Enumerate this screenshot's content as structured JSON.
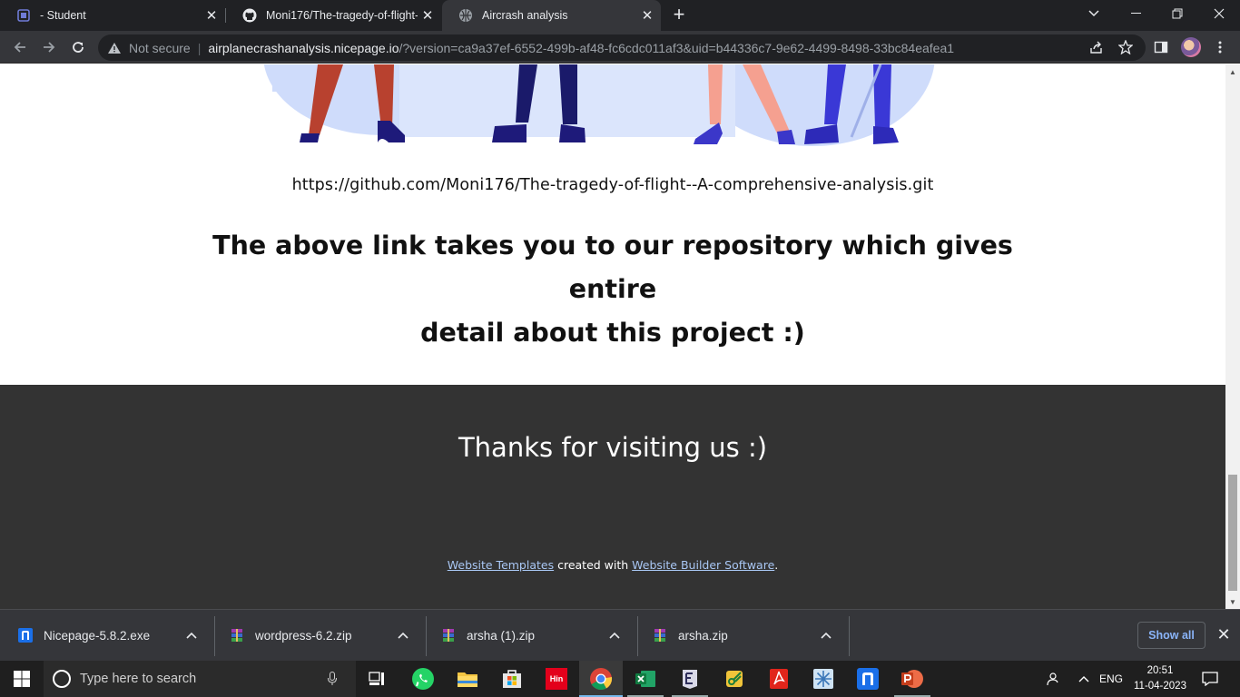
{
  "tabs": [
    {
      "title": "- Student",
      "icon": "teams-icon"
    },
    {
      "title": "Moni176/The-tragedy-of-flight--",
      "icon": "github-icon"
    },
    {
      "title": "Aircrash analysis",
      "icon": "globe-icon",
      "active": true
    }
  ],
  "address": {
    "security": "Not secure",
    "host": "airplanecrashanalysis.nicepage.io",
    "path": "/?version=ca9a37ef-6552-499b-af48-fc6cdc011af3&uid=b44336c7-9e62-4499-8498-33bc84eafea1"
  },
  "page": {
    "repo_link": "https://github.com/Moni176/The-tragedy-of-flight--A-comprehensive-analysis.git",
    "headline_line1": "The above link takes you to our repository which gives entire",
    "headline_line2": "detail about this project :)",
    "footer": {
      "thanks": "Thanks for visiting us :)",
      "credit_link1": "Website Templates",
      "credit_mid": " created with ",
      "credit_link2": "Website Builder Software",
      "credit_end": "."
    }
  },
  "downloads": {
    "items": [
      {
        "name": "Nicepage-5.8.2.exe",
        "icon": "nicepage-icon"
      },
      {
        "name": "wordpress-6.2.zip",
        "icon": "winrar-icon"
      },
      {
        "name": "arsha (1).zip",
        "icon": "winrar-icon"
      },
      {
        "name": "arsha.zip",
        "icon": "winrar-icon"
      }
    ],
    "show_all": "Show all"
  },
  "taskbar": {
    "search_placeholder": "Type here to search",
    "apps": [
      "task-view",
      "whatsapp",
      "file-explorer",
      "microsoft-store",
      "hin-app",
      "chrome",
      "excel",
      "epic-app",
      "snipping-tool",
      "acrobat",
      "snowflake-app",
      "nicepage",
      "powerpoint"
    ],
    "hin_label": "Hin",
    "lang": "ENG",
    "time": "20:51",
    "date": "11-04-2023"
  }
}
